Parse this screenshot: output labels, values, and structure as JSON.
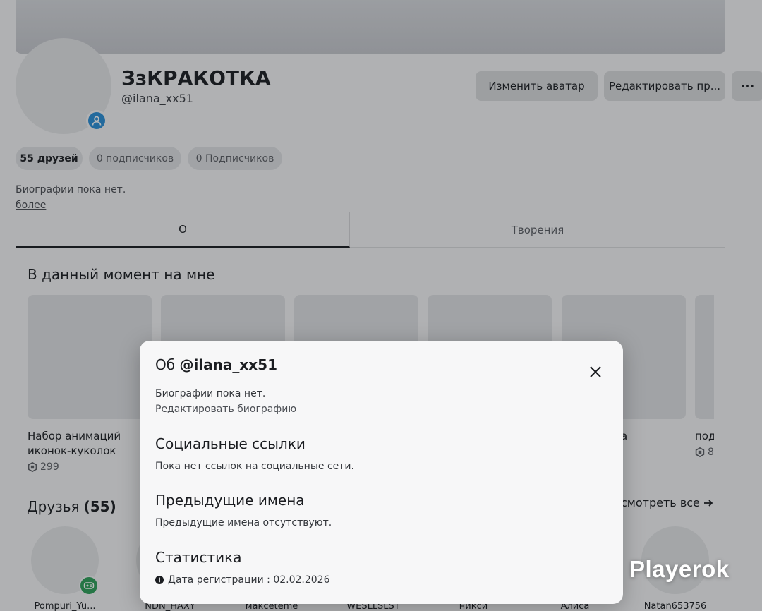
{
  "profile": {
    "display_name": "ЗзКРАКОТКА",
    "username": "@ilana_xx51",
    "buttons": {
      "change_avatar": "Изменить аватар",
      "edit_profile": "Редактировать пр...",
      "more": "···"
    },
    "stats": {
      "friends": "55 друзей",
      "followers": "0 подписчиков",
      "following": "0 Подписчиков"
    },
    "bio": "Биографии пока нет.",
    "more_link": "более"
  },
  "tabs": [
    {
      "label": "О"
    },
    {
      "label": "Творения"
    }
  ],
  "wearing": {
    "title": "В данный момент на мне",
    "items": [
      {
        "name": "Набор анимаций иконок-куколок",
        "price": "299"
      },
      {
        "name": "",
        "price": ""
      },
      {
        "name": "",
        "price": ""
      },
      {
        "name": "",
        "price": ""
      },
      {
        "name": "а",
        "price": ""
      },
      {
        "name": "под",
        "price": "8"
      }
    ]
  },
  "friends": {
    "title": "Друзья",
    "count": "(55)",
    "see_all": "смотреть все",
    "list": [
      {
        "name": "Pompuri_Yu..."
      },
      {
        "name": "NDN_HAXY"
      },
      {
        "name": "максеteme"
      },
      {
        "name": "WESLLSLST"
      },
      {
        "name": "никси"
      },
      {
        "name": "Алиса"
      },
      {
        "name": "Natan653756"
      }
    ]
  },
  "modal": {
    "title_prefix": "Об",
    "title_user": "@ilana_xx51",
    "bio": "Биографии пока нет.",
    "edit_bio": "Редактировать биографию",
    "social_heading": "Социальные ссылки",
    "social_text": "Пока нет ссылок на социальные сети.",
    "prev_names_heading": "Предыдущие имена",
    "prev_names_text": "Предыдущие имена отсутствуют.",
    "stats_heading": "Статистика",
    "join_date": "Дата регистрации : 02.02.2026"
  },
  "watermark": "Playerok",
  "colors": {
    "presence_blue": "#2a8fd6",
    "in_game_green": "#2fa05a"
  }
}
